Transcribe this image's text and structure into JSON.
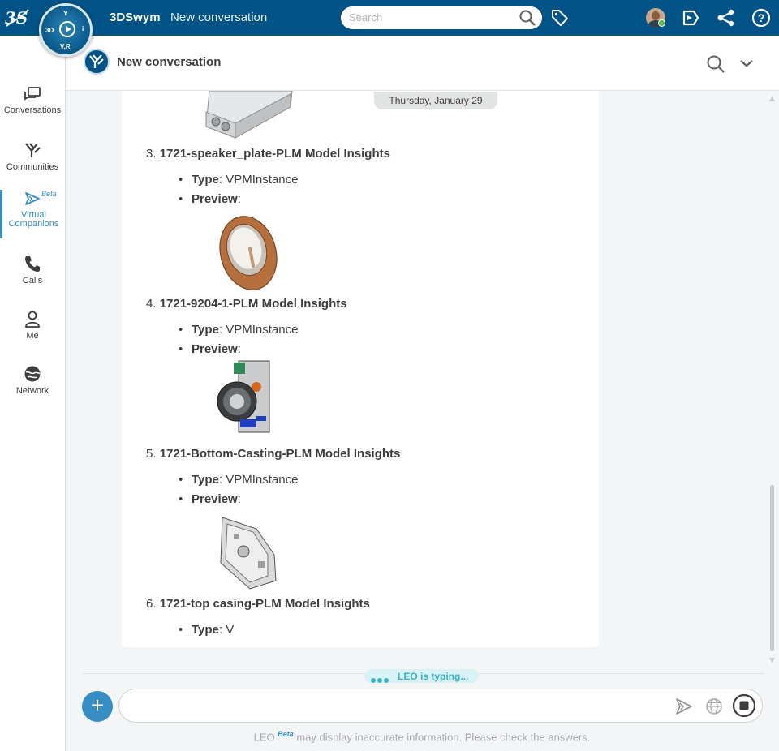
{
  "topbar": {
    "brand_logo_icon": "3ds-logo-icon",
    "compass_labels": {
      "top": "Y",
      "left": "3D",
      "right": "i",
      "bottom": "V,R"
    },
    "app_name": "3DSwym",
    "page_name": "New conversation",
    "search_placeholder": "Search",
    "icons": [
      "search-icon",
      "tag-icon",
      "avatar",
      "chat-bubble-icon",
      "share-icon",
      "help-icon"
    ]
  },
  "leftnav": {
    "items": [
      {
        "label": "Conversations",
        "icon": "conversations-icon"
      },
      {
        "label": "Communities",
        "icon": "communities-icon"
      },
      {
        "label": "Virtual\nCompanions",
        "label_line1": "Virtual",
        "label_line2": "Companions",
        "icon": "virtual-companions-icon",
        "badge": "Beta",
        "active": true
      },
      {
        "label": "Calls",
        "icon": "phone-icon"
      },
      {
        "label": "Me",
        "icon": "person-icon"
      },
      {
        "label": "Network",
        "icon": "globe-icon"
      }
    ]
  },
  "conversation": {
    "title": "New conversation",
    "date": "Thursday, January 29",
    "items": [
      {
        "num": "3.",
        "title": "1721-speaker_plate-PLM Model Insights",
        "type_label": "Type",
        "type_value": ": VPMInstance",
        "preview_label": "Preview",
        "preview_suffix": ":"
      },
      {
        "num": "4.",
        "title": "1721-9204-1-PLM Model Insights",
        "type_label": "Type",
        "type_value": ": VPMInstance",
        "preview_label": "Preview",
        "preview_suffix": ":"
      },
      {
        "num": "5.",
        "title": "1721-Bottom-Casting-PLM Model Insights",
        "type_label": "Type",
        "type_value": ": VPMInstance",
        "preview_label": "Preview",
        "preview_suffix": ":"
      },
      {
        "num": "6.",
        "title": "1721-top casing-PLM Model Insights",
        "type_label": "Type",
        "type_value": ": V"
      }
    ]
  },
  "composer": {
    "typing_text": "LEO is typing...",
    "placeholder": "",
    "disclaimer_leo": "LEO",
    "disclaimer_beta": "Beta",
    "disclaimer_text": "may display inaccurate information. Please check the answers."
  },
  "colors": {
    "topbar": "#005386",
    "accent": "#368ec4",
    "typing": "#3ab3c9"
  }
}
